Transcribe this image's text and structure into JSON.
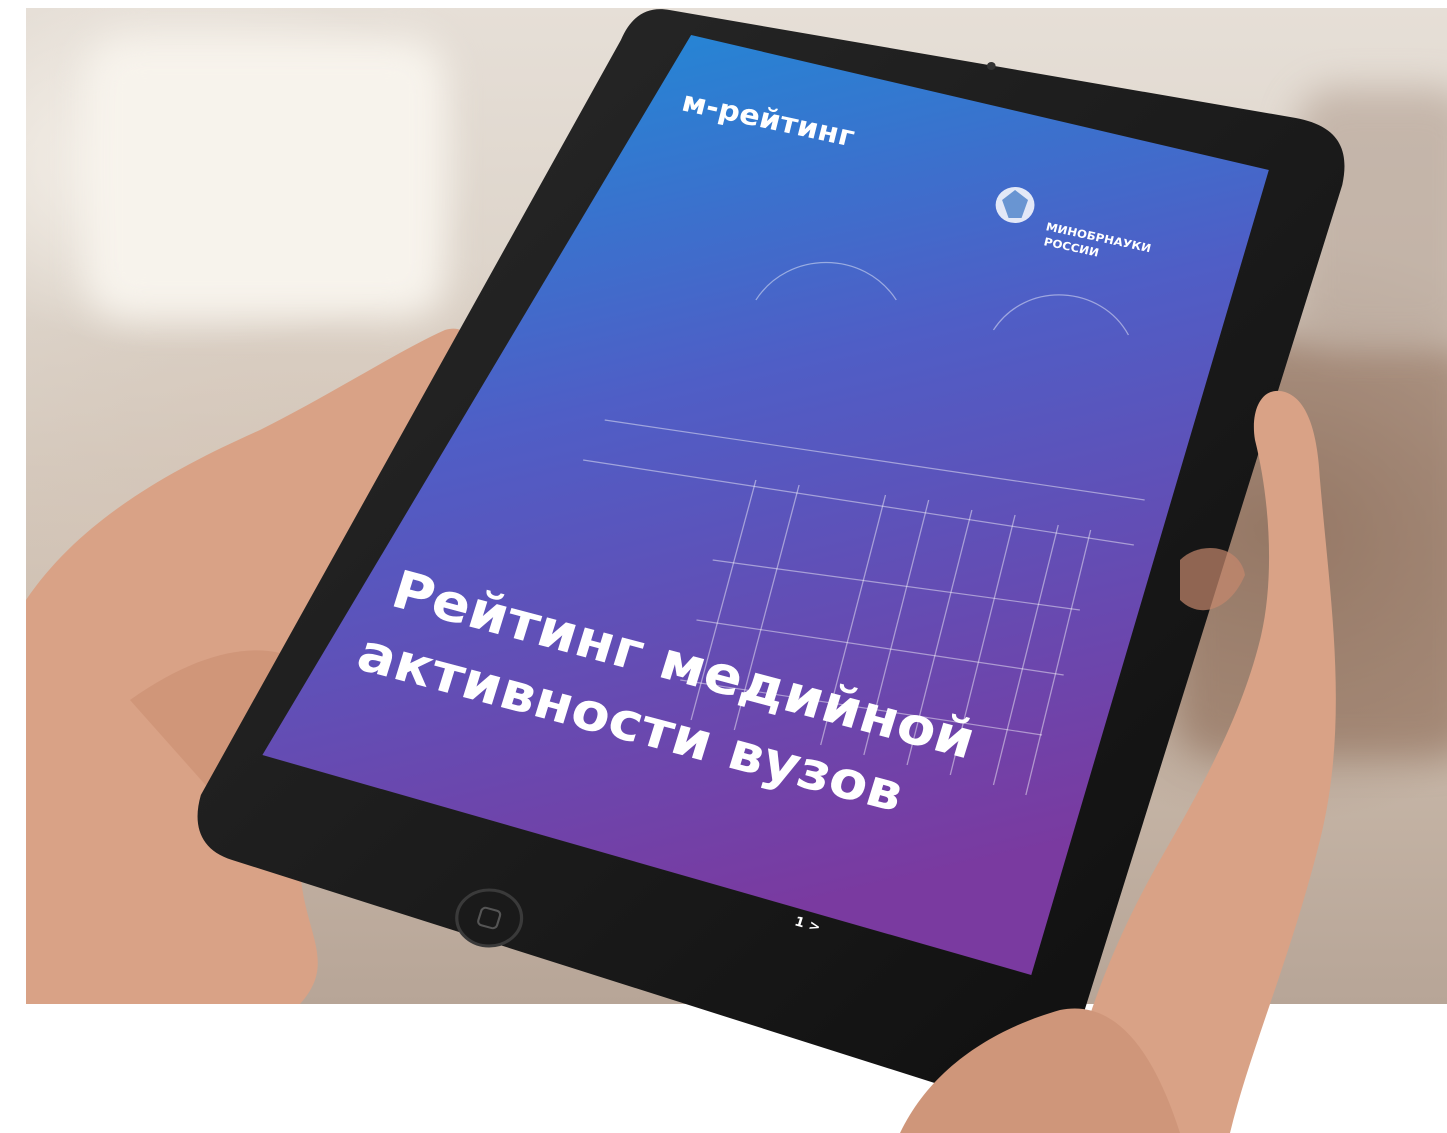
{
  "brand": "м-рейтинг",
  "ministry": {
    "line1": "МИНОБРНАУКИ",
    "line2": "РОССИИ"
  },
  "title": {
    "line1": "Рейтинг медийной",
    "line2": "активности вузов"
  },
  "page_indicator": "1 >",
  "colors": {
    "screen_top": "#1b8fd8",
    "screen_mid": "#5a55c4",
    "screen_bottom": "#7a3aa0",
    "bezel": "#141414"
  }
}
